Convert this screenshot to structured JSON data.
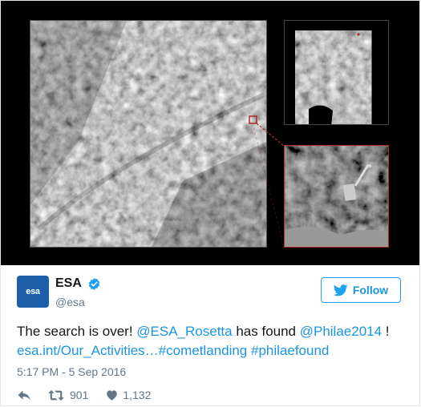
{
  "tweet": {
    "author_name": "ESA",
    "handle": "@esa",
    "avatar_text": "esa",
    "follow_label": "Follow",
    "text": {
      "t1": "The search is over! ",
      "mention1": "@ESA_Rosetta",
      "t2": " has found ",
      "mention2": "@Philae2014",
      "t3": " !",
      "link": "esa.int/Our_Activities…",
      "hashtag1": "#cometlanding",
      "hashtag2": "#philaefound"
    },
    "timestamp": "5:17 PM - 5 Sep 2016",
    "retweets": "901",
    "likes": "1,132"
  },
  "colors": {
    "accent": "#1b95e0",
    "follow_border": "#1da1f2",
    "muted": "#657786",
    "avatar_bg": "#1d5fa8",
    "callout_red": "#b02a2a"
  },
  "icons": [
    "esa-logo",
    "verified-badge-icon",
    "twitter-bird-icon",
    "reply-icon",
    "retweet-icon",
    "heart-icon"
  ]
}
